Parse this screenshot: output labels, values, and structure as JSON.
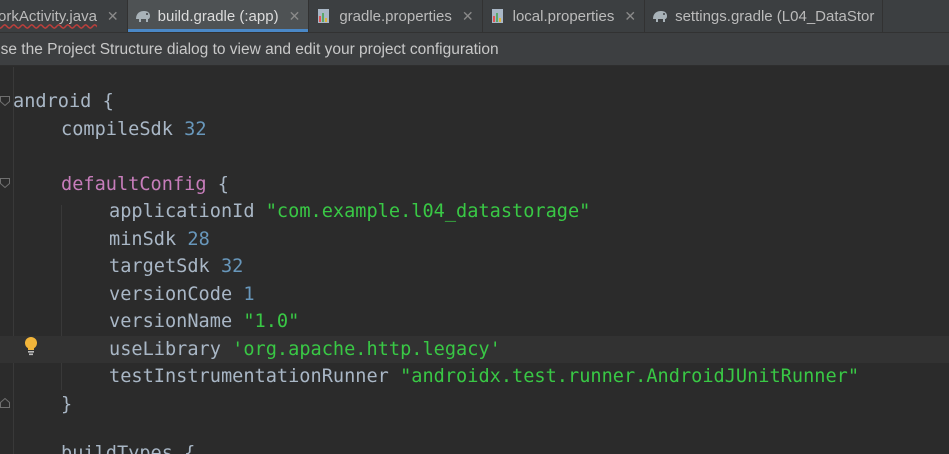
{
  "tabs": [
    {
      "label": "orkActivity.java",
      "icon": "java-class-icon",
      "active": false,
      "error": true
    },
    {
      "label": "build.gradle (:app)",
      "icon": "gradle-elephant-icon",
      "active": true,
      "error": false
    },
    {
      "label": "gradle.properties",
      "icon": "properties-file-icon",
      "active": false,
      "error": false
    },
    {
      "label": "local.properties",
      "icon": "properties-file-icon",
      "active": false,
      "error": false
    },
    {
      "label": "settings.gradle (L04_DataStor",
      "icon": "gradle-elephant-icon",
      "active": false,
      "error": false
    }
  ],
  "close_glyph": "✕",
  "banner": {
    "text": "use the Project Structure dialog to view and edit your project configuration"
  },
  "code": {
    "l1": {
      "name": "android",
      "brace": "{"
    },
    "l2": {
      "key": "compileSdk",
      "value": "32"
    },
    "l3": {
      "name": "defaultConfig",
      "brace": "{"
    },
    "l4": {
      "key": "applicationId",
      "value": "\"com.example.l04_datastorage\""
    },
    "l5": {
      "key": "minSdk",
      "value": "28"
    },
    "l6": {
      "key": "targetSdk",
      "value": "32"
    },
    "l7": {
      "key": "versionCode",
      "value": "1"
    },
    "l8": {
      "key": "versionName",
      "value": "\"1.0\""
    },
    "l9": {
      "key": "useLibrary",
      "value": "'org.apache.http.legacy'"
    },
    "l10": {
      "key": "testInstrumentationRunner",
      "value": "\"androidx.test.runner.AndroidJUnitRunner\""
    },
    "l11": {
      "brace": "}"
    },
    "l12": {
      "partial": "buildTypes {"
    }
  },
  "colors": {
    "keyword": "#c77dbb",
    "number": "#6897bb",
    "string": "#39c845",
    "text": "#a9b7c6"
  }
}
